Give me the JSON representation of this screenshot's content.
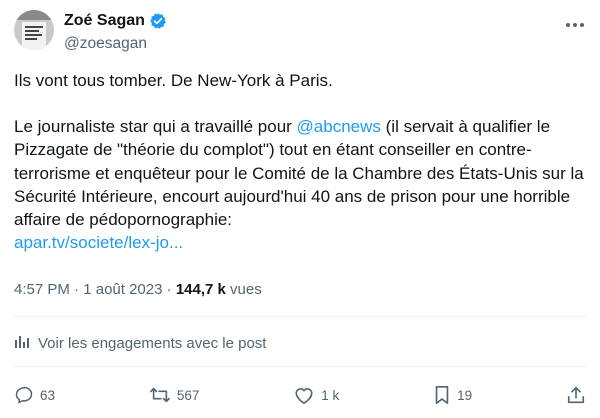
{
  "author": {
    "name": "Zoé Sagan",
    "handle": "@zoesagan",
    "verified_color": "#1d9bf0"
  },
  "tweet": {
    "line1": "Ils vont tous tomber. De New-York à Paris.",
    "p2_before_mention": "Le  journaliste star qui a travaillé pour ",
    "mention": "@abcnews",
    "p2_after_mention": " (il servait à qualifier le Pizzagate de \"théorie du complot\")  tout en étant conseiller en contre-terrorisme et enquêteur pour le Comité de la Chambre des États-Unis sur la Sécurité Intérieure, encourt aujourd'hui 40 ans de prison pour une horrible affaire de pédopornographie:",
    "link": "apar.tv/societe/lex-jo..."
  },
  "meta": {
    "time": "4:57 PM",
    "separator": "·",
    "date": "1 août 2023",
    "views_count": "144,7 k",
    "views_label": "vues"
  },
  "engagements_label": "Voir les engagements avec le post",
  "actions": {
    "replies": "63",
    "reposts": "567",
    "likes": "1 k",
    "bookmarks": "19"
  },
  "colors": {
    "link": "#1d9bf0",
    "secondary_text": "#536471",
    "primary_text": "#0f1419"
  },
  "icons": [
    "verified-badge-icon",
    "more-icon",
    "analytics-icon",
    "reply-icon",
    "repost-icon",
    "like-icon",
    "bookmark-icon",
    "share-icon"
  ]
}
